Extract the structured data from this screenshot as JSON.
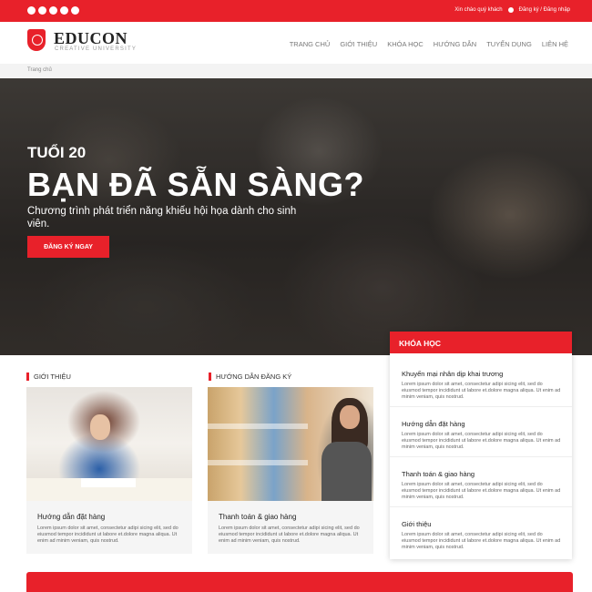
{
  "topbar": {
    "social_icons": [
      "facebook-icon",
      "twitter-icon",
      "google-plus-icon",
      "pinterest-icon",
      "instagram-icon"
    ],
    "greeting": "Xin chào quý khách",
    "login": "Đăng ký / Đăng nhập"
  },
  "header": {
    "logo_title": "EDUCON",
    "logo_subtitle": "CREATIVE UNIVERSITY",
    "nav": [
      "TRANG CHỦ",
      "GIỚI THIỆU",
      "KHÓA HỌC",
      "HƯỚNG DẪN",
      "TUYỂN DỤNG",
      "LIÊN HỆ"
    ]
  },
  "breadcrumb": "Trang chủ",
  "hero": {
    "kicker": "TUỔI 20",
    "title": "BẠN ĐÃ SẴN SÀNG?",
    "description": "Chương trình phát triển năng khiếu hội họa dành cho sinh viên.",
    "cta": "ĐĂNG KÝ NGAY"
  },
  "sections": {
    "intro_heading": "GIỚI THIỆU",
    "guide_heading": "HƯỚNG DẪN ĐĂNG KÝ"
  },
  "cards": [
    {
      "title": "Hướng dẫn đặt hàng",
      "text": "Lorem ipsum dolor sit amet, consectetur adipi sicing elit, sed do eiusmod tempor incididunt ut labore et.dolore magna aliqua. Ut enim ad minim veniam, quis nostrud."
    },
    {
      "title": "Thanh toán & giao hàng",
      "text": "Lorem ipsum dolor sit amet, consectetur adipi sicing elit, sed do eiusmod tempor incididunt ut labore et.dolore magna aliqua. Ut enim ad minim veniam, quis nostrud."
    }
  ],
  "courses": {
    "heading": "KHÓA HỌC",
    "items": [
      {
        "title": "Khuyến mại nhân dịp khai trương",
        "text": "Lorem ipsum dolor sit amet, consectetur adipi sicing elit, sed do eiusmod tempor incididunt ut labore et.dolore magna aliqua. Ut enim ad minim veniam, quis nostrud."
      },
      {
        "title": "Hướng dẫn đặt hàng",
        "text": "Lorem ipsum dolor sit amet, consectetur adipi sicing elit, sed do eiusmod tempor incididunt ut labore et.dolore magna aliqua. Ut enim ad minim veniam, quis nostrud."
      },
      {
        "title": "Thanh toán & giao hàng",
        "text": "Lorem ipsum dolor sit amet, consectetur adipi sicing elit, sed do eiusmod tempor incididunt ut labore et.dolore magna aliqua. Ut enim ad minim veniam, quis nostrud."
      },
      {
        "title": "Giới thiệu",
        "text": "Lorem ipsum dolor sit amet, consectetur adipi sicing elit, sed do eiusmod tempor incididunt ut labore et.dolore magna aliqua. Ut enim ad minim veniam, quis nostrud."
      }
    ]
  },
  "colors": {
    "brand_red": "#e8212a"
  }
}
